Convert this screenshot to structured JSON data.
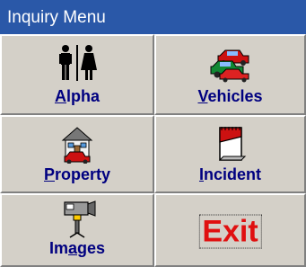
{
  "window": {
    "title": "Inquiry Menu"
  },
  "buttons": {
    "alpha": {
      "mnemonic": "A",
      "rest": "lpha",
      "icon": "people-icon"
    },
    "vehicles": {
      "mnemonic": "V",
      "rest": "ehicles",
      "icon": "cars-icon"
    },
    "property": {
      "mnemonic": "P",
      "rest": "roperty",
      "icon": "house-car-icon"
    },
    "incident": {
      "mnemonic": "I",
      "rest": "ncident",
      "icon": "notepad-icon"
    },
    "images": {
      "mnemonic": "a",
      "pre": "Im",
      "rest": "ges",
      "icon": "camera-icon"
    },
    "exit": {
      "label": "Exit"
    }
  },
  "colors": {
    "titlebar": "#2a58a8",
    "face": "#d4d0c8",
    "label": "#000080",
    "exit": "#e01010"
  }
}
